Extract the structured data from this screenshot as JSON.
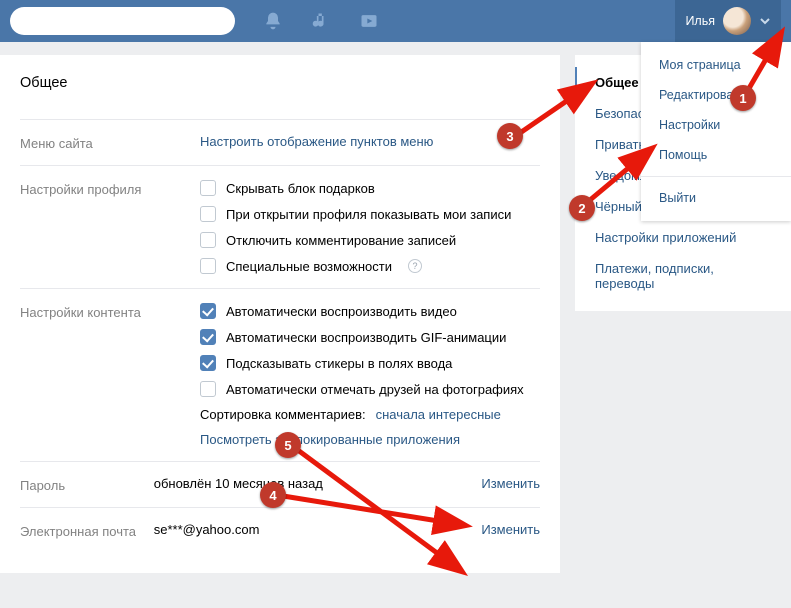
{
  "header": {
    "user_name": "Илья",
    "icons": {
      "bell": "bell-icon",
      "music": "music-icon",
      "video": "video-icon"
    }
  },
  "dropdown": {
    "my_page": "Моя страница",
    "edit": "Редактировать",
    "settings": "Настройки",
    "help": "Помощь",
    "logout": "Выйти"
  },
  "page": {
    "title": "Общее"
  },
  "menu_row": {
    "label": "Меню сайта",
    "link": "Настроить отображение пунктов меню"
  },
  "profile_row": {
    "label": "Настройки профиля",
    "opts": [
      {
        "text": "Скрывать блок подарков",
        "checked": false
      },
      {
        "text": "При открытии профиля показывать мои записи",
        "checked": false
      },
      {
        "text": "Отключить комментирование записей",
        "checked": false
      },
      {
        "text": "Специальные возможности",
        "checked": false,
        "hint": "?"
      }
    ]
  },
  "content_row": {
    "label": "Настройки контента",
    "opts": [
      {
        "text": "Автоматически воспроизводить видео",
        "checked": true
      },
      {
        "text": "Автоматически воспроизводить GIF-анимации",
        "checked": true
      },
      {
        "text": "Подсказывать стикеры в полях ввода",
        "checked": true
      },
      {
        "text": "Автоматически отмечать друзей на фотографиях",
        "checked": false
      }
    ],
    "sort_label": "Сортировка комментариев: ",
    "sort_value": "сначала интересные",
    "blocked_apps": "Посмотреть заблокированные приложения"
  },
  "password_row": {
    "label": "Пароль",
    "value": "обновлён 10 месяцев назад",
    "action": "Изменить"
  },
  "email_row": {
    "label": "Электронная почта",
    "value": "se***@yahoo.com",
    "action": "Изменить"
  },
  "side_nav": {
    "items": [
      "Общее",
      "Безопасность",
      "Приватность",
      "Уведомления",
      "Чёрный список",
      "Настройки приложений",
      "Платежи, подписки, переводы"
    ]
  },
  "annotations": {
    "n1": "1",
    "n2": "2",
    "n3": "3",
    "n4": "4",
    "n5": "5"
  }
}
